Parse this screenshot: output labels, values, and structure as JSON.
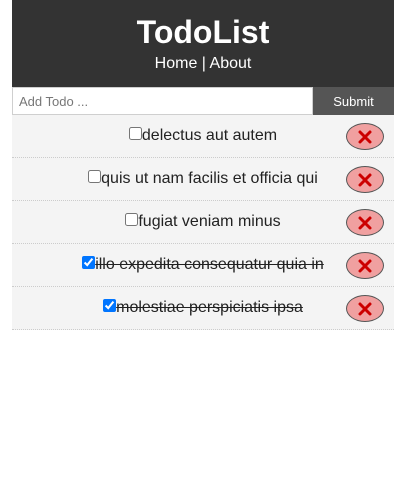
{
  "header": {
    "title": "TodoList",
    "nav": {
      "home": "Home",
      "separator": " | ",
      "about": "About"
    }
  },
  "add_form": {
    "placeholder": "Add Todo ...",
    "submit_label": "Submit"
  },
  "todos": [
    {
      "title": "delectus aut autem",
      "completed": false
    },
    {
      "title": "quis ut nam facilis et officia qui",
      "completed": false
    },
    {
      "title": "fugiat veniam minus",
      "completed": false
    },
    {
      "title": "illo expedita consequatur quia in",
      "completed": true
    },
    {
      "title": "molestiae perspiciatis ipsa",
      "completed": true
    }
  ],
  "colors": {
    "header_bg": "#333333",
    "submit_bg": "#555555",
    "delete_bg": "#f0a0a0",
    "delete_x": "#cc0000"
  },
  "icons": {
    "delete": "close-icon"
  }
}
